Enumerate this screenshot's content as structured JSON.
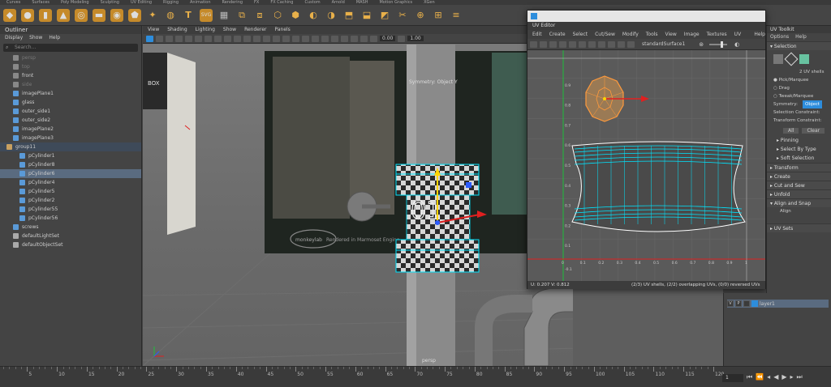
{
  "shelf_tabs": [
    "Curves",
    "Surfaces",
    "Poly Modeling",
    "Sculpting",
    "UV Editing",
    "Rigging",
    "Animation",
    "Rendering",
    "FX",
    "FX Caching",
    "Custom",
    "Arnold",
    "MASH",
    "Motion Graphics",
    "XGen"
  ],
  "outliner": {
    "title": "Outliner",
    "menu": [
      "Display",
      "Show",
      "Help"
    ],
    "search_placeholder": "Search...",
    "items": [
      {
        "label": "persp",
        "state": "dim",
        "indent": 16
      },
      {
        "label": "top",
        "state": "dim",
        "indent": 16
      },
      {
        "label": "front",
        "state": "normal",
        "indent": 16
      },
      {
        "label": "side",
        "state": "dim",
        "indent": 16
      },
      {
        "label": "imagePlane1",
        "state": "normal",
        "indent": 16
      },
      {
        "label": "glass",
        "state": "normal",
        "indent": 16
      },
      {
        "label": "outer_side1",
        "state": "normal",
        "indent": 16
      },
      {
        "label": "outer_side2",
        "state": "normal",
        "indent": 16
      },
      {
        "label": "imagePlane2",
        "state": "normal",
        "indent": 16
      },
      {
        "label": "imagePlane3",
        "state": "normal",
        "indent": 16
      },
      {
        "label": "group11",
        "state": "hl",
        "indent": 8
      },
      {
        "label": "pCylinder1",
        "state": "normal",
        "indent": 24
      },
      {
        "label": "pCylinder8",
        "state": "normal",
        "indent": 24
      },
      {
        "label": "pCylinder6",
        "state": "sel",
        "indent": 24
      },
      {
        "label": "pCylinder4",
        "state": "normal",
        "indent": 24
      },
      {
        "label": "pCylinder5",
        "state": "normal",
        "indent": 24
      },
      {
        "label": "pCylinder2",
        "state": "normal",
        "indent": 24
      },
      {
        "label": "pCylinder55",
        "state": "normal",
        "indent": 24
      },
      {
        "label": "pCylinder56",
        "state": "normal",
        "indent": 24
      },
      {
        "label": "screws",
        "state": "normal",
        "indent": 16
      },
      {
        "label": "defaultLightSet",
        "state": "normal",
        "indent": 16
      },
      {
        "label": "defaultObjectSet",
        "state": "normal",
        "indent": 16
      }
    ]
  },
  "viewport": {
    "menu": [
      "View",
      "Shading",
      "Lighting",
      "Show",
      "Renderer",
      "Panels"
    ],
    "exposure": "0.00",
    "gamma": "1.00",
    "symmetry_label": "Symmetry: Object Y",
    "camera_label": "persp",
    "watermark": "Rendered in Marmoset Engine",
    "logo_text": "monkeylab",
    "crate_text": "BOX"
  },
  "uv_editor": {
    "title": "UV Editor",
    "menu": [
      "Edit",
      "Create",
      "Select",
      "Cut/Sew",
      "Modify",
      "Tools",
      "View",
      "Image",
      "Textures",
      "UV Sets",
      "Help"
    ],
    "material": "standardSurface1",
    "coords": "U: 0.207  V: 0.812",
    "status": "(2/3) UV shells, (2/2) overlapping UVs, (0/0) reversed UVs",
    "x_ticks": [
      "0",
      "0.1",
      "0.2",
      "0.3",
      "0.4",
      "0.5",
      "0.6",
      "0.7",
      "0.8",
      "0.9",
      "1"
    ],
    "y_ticks": [
      "0.9",
      "0.8",
      "0.7",
      "0.6",
      "0.5",
      "0.4",
      "0.3",
      "0.2",
      "0.1",
      "-0.1"
    ]
  },
  "uv_toolkit": {
    "title": "UV Toolkit",
    "menu": [
      "Options",
      "Help"
    ],
    "selection_header": "Selection",
    "shells_label": "2 UV shells",
    "modes": [
      "Pick/Marquee",
      "Drag",
      "Tweak/Marquee"
    ],
    "symmetry_label": "Symmetry:",
    "symmetry_value": "Object",
    "constraint_label": "Selection Constraint:",
    "transform_constraint_label": "Transform Constraint:",
    "all_button": "All",
    "clear_button": "Clear",
    "subsections": [
      "Pinning",
      "Select By Type",
      "Soft Selection"
    ],
    "sections": [
      "Transform",
      "Create",
      "Cut and Sew",
      "Unfold",
      "Align and Snap"
    ],
    "align_label": "Align",
    "uv_sets_section": "UV Sets"
  },
  "layers": {
    "v": "V",
    "p": "P",
    "name": "layer1"
  },
  "timeline": {
    "ticks": [
      "5",
      "10",
      "15",
      "20",
      "25",
      "30",
      "35",
      "40",
      "45",
      "50",
      "55",
      "60",
      "65",
      "70",
      "75",
      "80",
      "85",
      "90",
      "95",
      "100",
      "105",
      "110",
      "115",
      "120"
    ],
    "current_frame": "1",
    "range_start": 1,
    "range_end": 120
  },
  "colors": {
    "selection_blue": "#5a6b80",
    "uv_cyan": "#00e5ff",
    "uv_orange": "#ff9a3c",
    "accent": "#2d8ddc"
  }
}
